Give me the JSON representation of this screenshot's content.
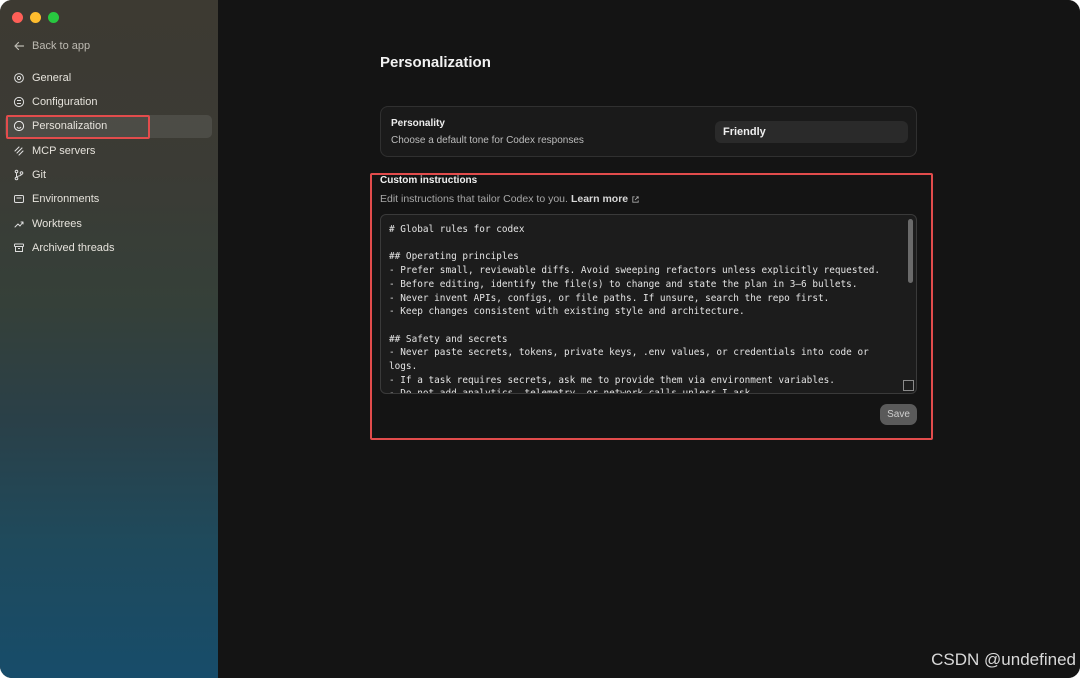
{
  "sidebar": {
    "back_label": "Back to app",
    "items": [
      {
        "label": "General",
        "icon": "gear-icon"
      },
      {
        "label": "Configuration",
        "icon": "sliders-icon"
      },
      {
        "label": "Personalization",
        "icon": "smiley-icon",
        "active": true
      },
      {
        "label": "MCP servers",
        "icon": "mcp-icon"
      },
      {
        "label": "Git",
        "icon": "git-branch-icon"
      },
      {
        "label": "Environments",
        "icon": "terminal-window-icon"
      },
      {
        "label": "Worktrees",
        "icon": "worktree-icon"
      },
      {
        "label": "Archived threads",
        "icon": "archive-box-icon"
      }
    ]
  },
  "main": {
    "title": "Personalization",
    "personality": {
      "label": "Personality",
      "description": "Choose a default tone for Codex responses",
      "selected": "Friendly"
    },
    "custom_instructions": {
      "title": "Custom instructions",
      "description": "Edit instructions that tailor Codex to you.",
      "learn_more": "Learn more",
      "content": "# Global rules for codex\n\n## Operating principles\n- Prefer small, reviewable diffs. Avoid sweeping refactors unless explicitly requested.\n- Before editing, identify the file(s) to change and state the plan in 3–6 bullets.\n- Never invent APIs, configs, or file paths. If unsure, search the repo first.\n- Keep changes consistent with existing style and architecture.\n\n## Safety and secrets\n- Never paste secrets, tokens, private keys, .env values, or credentials into code or logs.\n- If a task requires secrets, ask me to provide them via environment variables.\n- Do not add analytics, telemetry, or network calls unless I ask.",
      "save_label": "Save"
    }
  },
  "watermark": "CSDN @undefined",
  "colors": {
    "highlight": "#e24c4c",
    "sidebar_top": "#3d3a32",
    "sidebar_bottom": "#174c6a",
    "main_bg": "#141414"
  }
}
